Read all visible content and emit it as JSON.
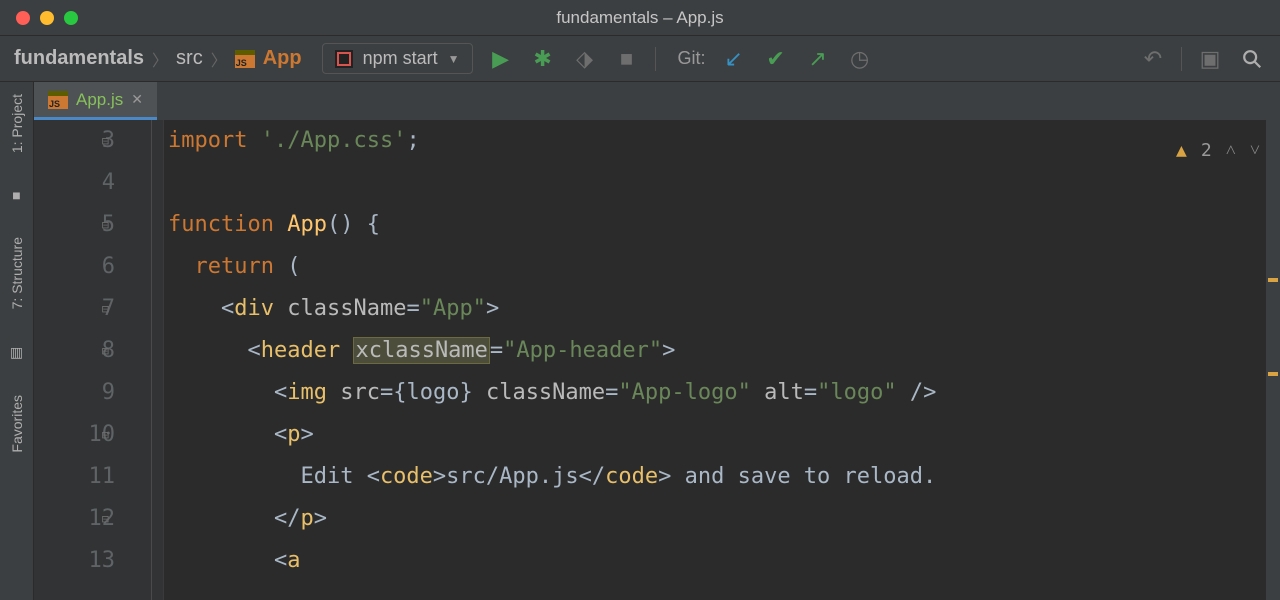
{
  "window_title": "fundamentals – App.js",
  "breadcrumbs": {
    "root": "fundamentals",
    "folder": "src",
    "file": "App"
  },
  "run_config": "npm start",
  "git_label": "Git:",
  "tab": {
    "label": "App.js"
  },
  "warning_count": "2",
  "sidebar": {
    "project": "1: Project",
    "structure": "7: Structure",
    "favorites": "Favorites"
  },
  "lines": {
    "n3": "3",
    "n4": "4",
    "n5": "5",
    "n6": "6",
    "n7": "7",
    "n8": "8",
    "n9": "9",
    "n10": "10",
    "n11": "11",
    "n12": "12",
    "n13": "13"
  },
  "code": {
    "l3_kw": "import",
    "l3_str": "'./App.css'",
    "l3_semi": ";",
    "l5_kw": "function",
    "l5_fn": "App",
    "l5_rest": "() {",
    "l6_kw": "return",
    "l6_rest": " (",
    "l7_open": "<",
    "l7_tag": "div",
    "l7_attr": "className",
    "l7_eq": "=",
    "l7_val": "\"App\"",
    "l7_close": ">",
    "l8_open": "<",
    "l8_tag": "header",
    "l8_attr": "xclassName",
    "l8_eq": "=",
    "l8_val": "\"App-header\"",
    "l8_close": ">",
    "l9_open": "<",
    "l9_tag": "img",
    "l9_a1": "src",
    "l9_v1": "{logo}",
    "l9_a2": "className",
    "l9_v2": "\"App-logo\"",
    "l9_a3": "alt",
    "l9_v3": "\"logo\"",
    "l9_close": " />",
    "l10_open": "<",
    "l10_tag": "p",
    "l10_close": ">",
    "l11_txt1": "Edit ",
    "l11_open": "<",
    "l11_tag": "code",
    "l11_close1": ">",
    "l11_txt2": "src/App.js",
    "l11_open2": "</",
    "l11_tag2": "code",
    "l11_close2": ">",
    "l11_txt3": " and save to reload.",
    "l12_open": "</",
    "l12_tag": "p",
    "l12_close": ">",
    "l13_open": "<",
    "l13_tag": "a"
  }
}
